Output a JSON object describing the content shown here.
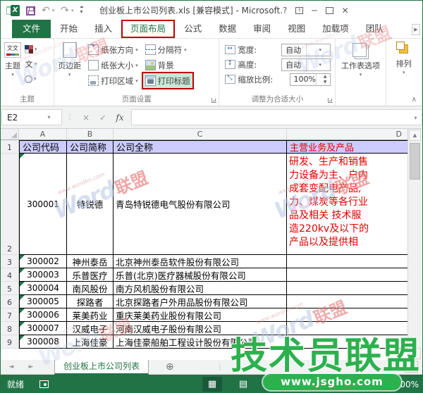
{
  "colors": {
    "excel_green": "#217346",
    "table_header_fill": "#ccccff",
    "red_cell_text": "#e00000",
    "annotation_red": "#c00000",
    "watermark_green": "#2cb14e"
  },
  "title_bar": {
    "title": "创业板上市公司列表.xls [兼容模式] - Microsoft..."
  },
  "ribbon": {
    "tabs": [
      {
        "label": "文件",
        "file": true
      },
      {
        "label": "开始"
      },
      {
        "label": "插入"
      },
      {
        "label": "页面布局",
        "active": true
      },
      {
        "label": "公式"
      },
      {
        "label": "数据"
      },
      {
        "label": "审阅"
      },
      {
        "label": "视图"
      },
      {
        "label": "加载项"
      },
      {
        "label": "团队"
      }
    ],
    "themes_group": {
      "label": "主题",
      "themes_button": "主题"
    },
    "page_setup_group": {
      "label": "页面设置",
      "margins": "页边距",
      "orientation": "纸张方向",
      "paper_size": "纸张大小",
      "print_area": "打印区域",
      "breaks": "分隔符",
      "background": "背景",
      "print_titles": "打印标题"
    },
    "scale_group": {
      "label": "调整为合适大小",
      "width_label": "宽度:",
      "width_value": "自动",
      "height_label": "高度:",
      "height_value": "自动",
      "scale_label": "缩放比例:",
      "scale_value": "100%"
    },
    "sheet_options_label": "工作表选项",
    "arrange_label": "排列"
  },
  "formula_bar": {
    "name_box": "E2",
    "fx_label": "fx",
    "formula": ""
  },
  "grid": {
    "columns": [
      "A",
      "B",
      "C",
      "D"
    ],
    "header_row": {
      "row": "1",
      "code": "公司代码",
      "short_name": "公司简称",
      "full_name": "公司全称",
      "main_business": "主营业务及产品"
    },
    "rows": [
      {
        "row": "2",
        "code": "300001",
        "short_name": "特锐德",
        "full_name": "青岛特锐德电气股份有限公司",
        "main_business": "研发、生产和销售\n力设备为主、户内\n成套变配电产品,\n力、煤炭等各行业\n品及相关 技术服\n造220kv及以下的\n产品以及提供相"
      },
      {
        "row": "3",
        "code": "300002",
        "short_name": "神州泰岳",
        "full_name": "北京神州泰岳软件股份有限公司",
        "main_business": ""
      },
      {
        "row": "4",
        "code": "300003",
        "short_name": "乐普医疗",
        "full_name": "乐普(北京)医疗器械股份有限公司",
        "main_business": ""
      },
      {
        "row": "5",
        "code": "300004",
        "short_name": "南风股份",
        "full_name": "南方风机股份有限公司",
        "main_business": ""
      },
      {
        "row": "6",
        "code": "300005",
        "short_name": "探路者",
        "full_name": "北京探路者户外用品股份有限公司",
        "main_business": ""
      },
      {
        "row": "7",
        "code": "300006",
        "short_name": "莱美药业",
        "full_name": "重庆莱美药业股份有限公司",
        "main_business": ""
      },
      {
        "row": "8",
        "code": "300007",
        "short_name": "汉威电子",
        "full_name": "河南汉威电子股份有限公司",
        "main_business": ""
      },
      {
        "row": "9",
        "code": "300008",
        "short_name": "上海佳豪",
        "full_name": "上海佳豪船舶工程设计股份有限公司",
        "main_business": ""
      }
    ]
  },
  "sheet_tabs": {
    "active_tab": "创业板上市公司列表"
  },
  "status_bar": {
    "mode": "就绪",
    "zoom": "100%"
  },
  "watermarks": {
    "wordlm": {
      "word": "Word",
      "suffix": "联盟",
      "url": "www.wordlm.com"
    },
    "jsgho": {
      "title": "技术员联盟",
      "url": "www.jsgho.com"
    }
  }
}
